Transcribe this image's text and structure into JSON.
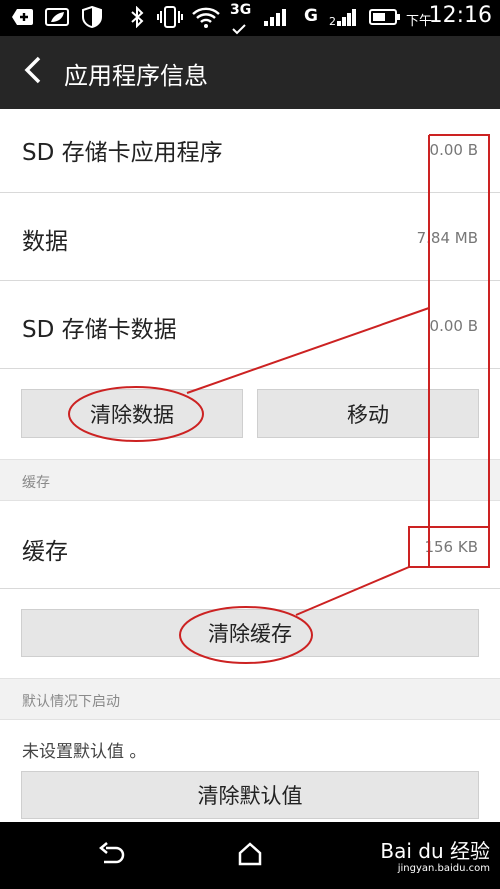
{
  "status_bar": {
    "time": "12:16",
    "time_prefix": "下午",
    "network_3g": "3G",
    "network_g": "G",
    "icons": [
      "plus-icon",
      "leaf-icon",
      "shield-icon",
      "bluetooth-icon",
      "vibrate-icon",
      "wifi-icon",
      "signal-icon",
      "battery-icon"
    ]
  },
  "app_bar": {
    "title": "应用程序信息",
    "back_icon": "chevron-left-icon"
  },
  "storage": {
    "rows": [
      {
        "label": "SD 存储卡应用程序",
        "value": "0.00 B"
      },
      {
        "label": "数据",
        "value": "7.84 MB"
      },
      {
        "label": "SD 存储卡数据",
        "value": "0.00 B"
      }
    ],
    "buttons": {
      "clear_data": "清除数据",
      "move": "移动"
    }
  },
  "cache": {
    "section_title": "缓存",
    "row_label": "缓存",
    "row_value": "156 KB",
    "clear_button": "清除缓存"
  },
  "defaults": {
    "section_title": "默认情况下启动",
    "status_text": "未设置默认值 。",
    "clear_button": "清除默认值"
  },
  "nav_bar": {
    "icons": [
      "back-icon",
      "home-icon"
    ]
  },
  "watermark": {
    "brand": "Bai du 经验",
    "url": "jingyan.baidu.com"
  },
  "colors": {
    "annotation": "#cc2222",
    "app_bar": "#262626",
    "button_bg": "#e6e6e6",
    "section_bg": "#f2f2f2"
  }
}
